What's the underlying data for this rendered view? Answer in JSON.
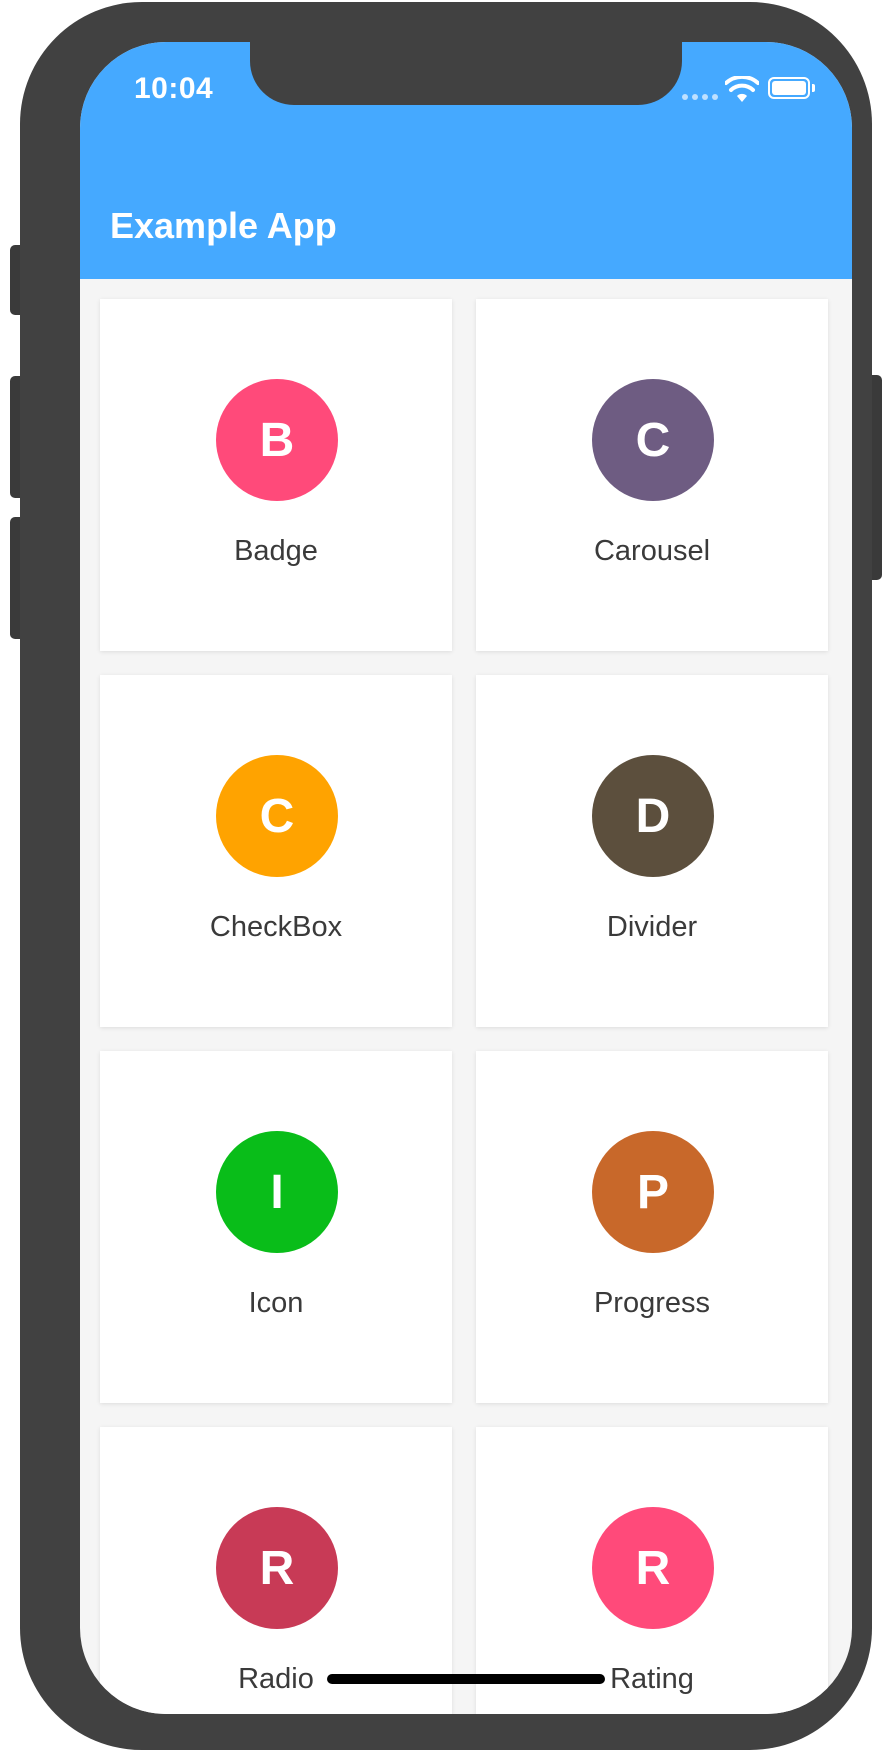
{
  "statusbar": {
    "time": "10:04",
    "wifi_icon": "wifi-icon",
    "battery_icon": "battery-full-icon",
    "signal_icon": "cellular-signal-icon",
    "color": "#45a9ff"
  },
  "appbar": {
    "title": "Example App",
    "color": "#45a9ff"
  },
  "tiles": [
    {
      "letter": "B",
      "label": "Badge",
      "color": "#ff4a7a"
    },
    {
      "letter": "C",
      "label": "Carousel",
      "color": "#6e5c82"
    },
    {
      "letter": "C",
      "label": "CheckBox",
      "color": "#ffa300"
    },
    {
      "letter": "D",
      "label": "Divider",
      "color": "#5c4f3d"
    },
    {
      "letter": "I",
      "label": "Icon",
      "color": "#09bd19"
    },
    {
      "letter": "P",
      "label": "Progress",
      "color": "#c8682a"
    },
    {
      "letter": "R",
      "label": "Radio",
      "color": "#c83a56"
    },
    {
      "letter": "R",
      "label": "Rating",
      "color": "#ff4a7a"
    }
  ]
}
